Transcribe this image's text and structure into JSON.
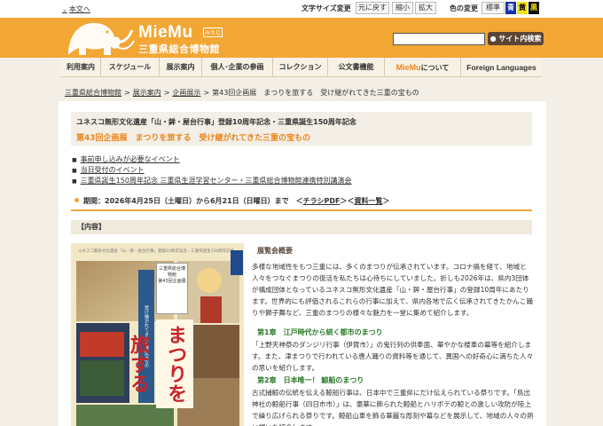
{
  "topbar": {
    "skip_link": "本文へ",
    "font_size_label": "文字サイズ変更",
    "font_size_reset": "元に戻す",
    "font_size_small": "縮小",
    "font_size_large": "拡大",
    "color_label": "色の変更",
    "color_standard": "標準",
    "color_blue": "青",
    "color_yellow": "黄",
    "color_black": "黒"
  },
  "header": {
    "logo_main": "MieMu",
    "logo_kana": "みえむ",
    "logo_sub": "三重県総合博物館",
    "search_placeholder": "",
    "search_button": "サイト内検索",
    "colors": {
      "orange": "#f2a634",
      "brown": "#5b4536"
    }
  },
  "nav": {
    "items": [
      {
        "label": "利用案内"
      },
      {
        "label": "スケジュール"
      },
      {
        "label": "展示案内"
      },
      {
        "label": "個人･企業の参画"
      },
      {
        "label": "コレクション"
      },
      {
        "label": "公文書機能"
      },
      {
        "label_brand": "MieMu",
        "label": "について"
      },
      {
        "label": "Foreign Languages"
      }
    ]
  },
  "breadcrumb": {
    "items": [
      "三重県総合博物館",
      "展示案内",
      "企画展示",
      "第43回企画展　まつりを旅する　受け継がれてきた三重の宝もの"
    ],
    "separator": ">"
  },
  "page": {
    "pre_title": "ユネスコ無形文化遺産「山・鉾・屋台行事」登録10周年記念・三重県誕生150周年記念",
    "title": "第43回企画展　まつりを旅する　受け継がれてきた三重の宝もの",
    "links": [
      "事前申し込みが必要なイベント",
      "当日受付のイベント",
      "三重県誕生150周年記念 三重県生涯学習センター・三重県総合博物館連携特別講演会"
    ],
    "period_text": "期間：2026年4月25日（土曜日）から6月21日（日曜日）まで　＜",
    "period_link1": "チラシPDF",
    "period_mid": "＞＜",
    "period_link2": "資料一覧",
    "period_end": "＞",
    "content_label": "【内容】",
    "overview_heading": "展覧会概要",
    "overview_text": "多様な地域性をもつ三重には、多くのまつりが伝承されています。コロナ禍を経て、地域と人々をつなぐまつりの復活を私たちは心待ちにしていました。折しも2026年は、県内3団体が構成団体となっているユネスコ無形文化遺産「山・鉾・屋台行事」の登録10周年にあたります。世界的にも評価されるこれらの行事に加えて、県内各地で広く伝承されてきたかんこ踊りや獅子舞など、三重のまつりの様々な魅力を一堂に集めて紹介します。",
    "chapter1_title": "第1章　江戸時代から続く都市のまつり",
    "chapter1_text": "「上野天神祭のダンジリ行事（伊賀市）」の鬼行列の供奉面、華やかな楼車の幕等を紹介します。また、津まつりで行われている唐人踊りの資料等を通じて、異国への好奇心に満ちた人々の思いを紹介します。",
    "chapter2_title": "第2章　日本唯一！ 鯨船のまつり",
    "chapter2_text": "古式捕鯨の伝統を伝える鯨船行事は、日本中で三重県にだけ伝えられている祭りです。「鳥出神社の鯨船行事（四日市市）」は、豪華に飾られた鯨船とハリボテの鯨との激しい攻防が陸上で繰り広げられる祭りです。鯨船山車を飾る華麗な彫刻や幕などを展示して、地域の人々の熱い想いを紹介します。"
  },
  "poster": {
    "caption": "ユネスコ無形文化遺産「山・鉾・屋台行事」登録10周年記念・三重県誕生150周年記念",
    "org": "三重県総合博物館",
    "exhibit_no": "第43回企画展",
    "title_big": "まつりを旅する",
    "subtitle": "受け継がれてきた三重の宝もの"
  }
}
